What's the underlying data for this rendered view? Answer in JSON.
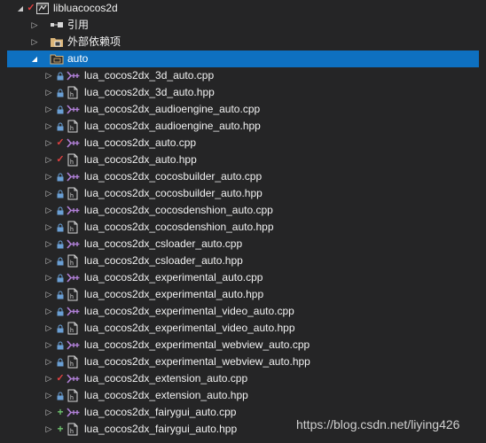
{
  "project": {
    "name": "libluacocos2d",
    "icon": "project-icon",
    "status": "checked-out"
  },
  "nodes": {
    "references": {
      "label": "引用",
      "icon": "references-icon"
    },
    "external_deps": {
      "label": "外部依赖项",
      "icon": "external-dependencies-icon"
    },
    "auto_folder": {
      "label": "auto",
      "icon": "filter-folder-icon"
    }
  },
  "files": [
    {
      "name": "lua_cocos2dx_3d_auto.cpp",
      "type": "cpp",
      "status": "lock"
    },
    {
      "name": "lua_cocos2dx_3d_auto.hpp",
      "type": "hpp",
      "status": "lock"
    },
    {
      "name": "lua_cocos2dx_audioengine_auto.cpp",
      "type": "cpp",
      "status": "lock"
    },
    {
      "name": "lua_cocos2dx_audioengine_auto.hpp",
      "type": "hpp",
      "status": "lock"
    },
    {
      "name": "lua_cocos2dx_auto.cpp",
      "type": "cpp",
      "status": "check"
    },
    {
      "name": "lua_cocos2dx_auto.hpp",
      "type": "hpp",
      "status": "check"
    },
    {
      "name": "lua_cocos2dx_cocosbuilder_auto.cpp",
      "type": "cpp",
      "status": "lock"
    },
    {
      "name": "lua_cocos2dx_cocosbuilder_auto.hpp",
      "type": "hpp",
      "status": "lock"
    },
    {
      "name": "lua_cocos2dx_cocosdenshion_auto.cpp",
      "type": "cpp",
      "status": "lock"
    },
    {
      "name": "lua_cocos2dx_cocosdenshion_auto.hpp",
      "type": "hpp",
      "status": "lock"
    },
    {
      "name": "lua_cocos2dx_csloader_auto.cpp",
      "type": "cpp",
      "status": "lock"
    },
    {
      "name": "lua_cocos2dx_csloader_auto.hpp",
      "type": "hpp",
      "status": "lock"
    },
    {
      "name": "lua_cocos2dx_experimental_auto.cpp",
      "type": "cpp",
      "status": "lock"
    },
    {
      "name": "lua_cocos2dx_experimental_auto.hpp",
      "type": "hpp",
      "status": "lock"
    },
    {
      "name": "lua_cocos2dx_experimental_video_auto.cpp",
      "type": "cpp",
      "status": "lock"
    },
    {
      "name": "lua_cocos2dx_experimental_video_auto.hpp",
      "type": "hpp",
      "status": "lock"
    },
    {
      "name": "lua_cocos2dx_experimental_webview_auto.cpp",
      "type": "cpp",
      "status": "lock"
    },
    {
      "name": "lua_cocos2dx_experimental_webview_auto.hpp",
      "type": "hpp",
      "status": "lock"
    },
    {
      "name": "lua_cocos2dx_extension_auto.cpp",
      "type": "cpp",
      "status": "check"
    },
    {
      "name": "lua_cocos2dx_extension_auto.hpp",
      "type": "hpp",
      "status": "lock"
    },
    {
      "name": "lua_cocos2dx_fairygui_auto.cpp",
      "type": "cpp",
      "status": "add"
    },
    {
      "name": "lua_cocos2dx_fairygui_auto.hpp",
      "type": "hpp",
      "status": "add"
    }
  ],
  "watermark": "https://blog.csdn.net/liying426",
  "colors": {
    "background": "#252526",
    "selection": "#0e70c0",
    "text": "#f1f1f1",
    "checked_out": "#e04040",
    "locked": "#6a9fd4",
    "added": "#6ec26e",
    "cpp_icon": "#b180d7"
  }
}
